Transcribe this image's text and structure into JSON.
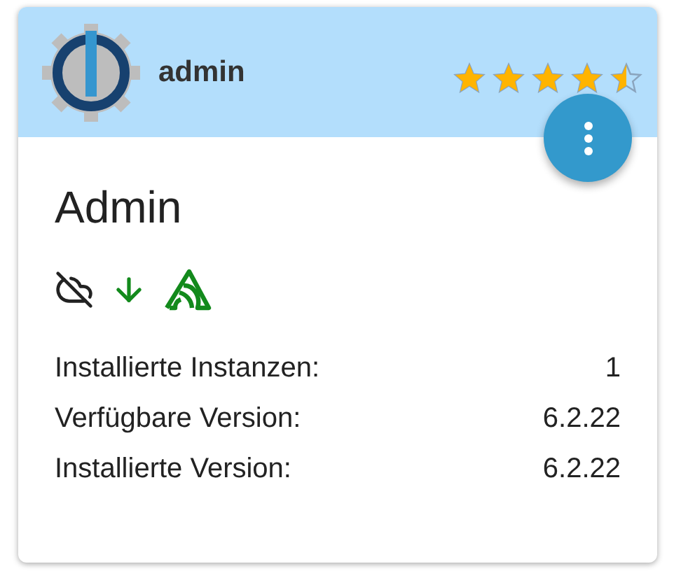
{
  "adapter": {
    "name": "admin",
    "stars": 4.5,
    "title": "Admin"
  },
  "details": [
    {
      "label": "Installierte Instanzen:",
      "value": "1"
    },
    {
      "label": "Verfügbare Version:",
      "value": "6.2.22"
    },
    {
      "label": "Installierte Version:",
      "value": "6.2.22"
    }
  ]
}
